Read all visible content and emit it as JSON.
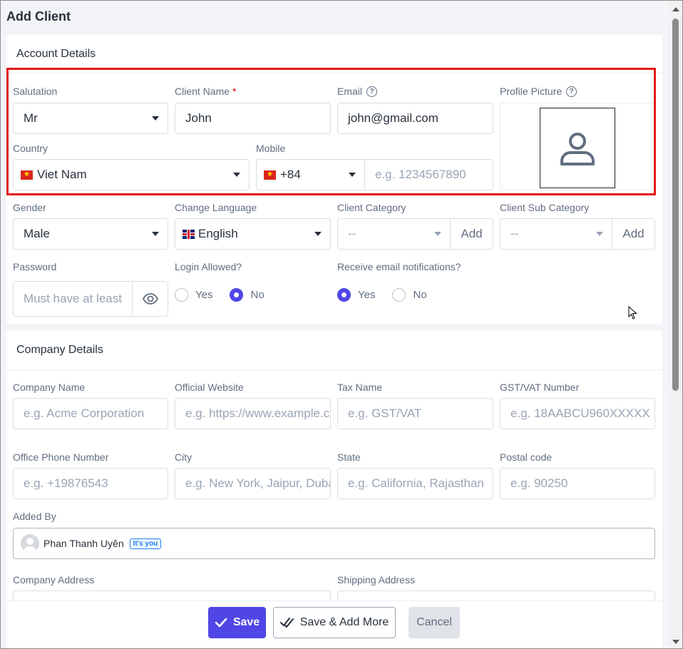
{
  "page": {
    "title": "Add Client"
  },
  "account": {
    "heading": "Account Details",
    "salutation": {
      "label": "Salutation",
      "value": "Mr"
    },
    "client_name": {
      "label": "Client Name",
      "required": "*",
      "value": "John"
    },
    "email": {
      "label": "Email",
      "value": "john@gmail.com"
    },
    "profile_picture": {
      "label": "Profile Picture"
    },
    "country": {
      "label": "Country",
      "value": "Viet Nam"
    },
    "mobile": {
      "label": "Mobile",
      "code": "+84",
      "placeholder": "e.g. 1234567890"
    },
    "gender": {
      "label": "Gender",
      "value": "Male"
    },
    "language": {
      "label": "Change Language",
      "value": "English"
    },
    "client_category": {
      "label": "Client Category",
      "value": "--",
      "add": "Add"
    },
    "client_sub_category": {
      "label": "Client Sub Category",
      "value": "--",
      "add": "Add"
    },
    "password": {
      "label": "Password",
      "placeholder": "Must have at least"
    },
    "login_allowed": {
      "label": "Login Allowed?",
      "yes": "Yes",
      "no": "No",
      "selected": "No"
    },
    "email_notifications": {
      "label": "Receive email notifications?",
      "yes": "Yes",
      "no": "No",
      "selected": "Yes"
    }
  },
  "company": {
    "heading": "Company Details",
    "company_name": {
      "label": "Company Name",
      "placeholder": "e.g. Acme Corporation"
    },
    "website": {
      "label": "Official Website",
      "placeholder": "e.g. https://www.example.com"
    },
    "tax_name": {
      "label": "Tax Name",
      "placeholder": "e.g. GST/VAT"
    },
    "gst": {
      "label": "GST/VAT Number",
      "placeholder": "e.g. 18AABCU960XXXXX"
    },
    "office_phone": {
      "label": "Office Phone Number",
      "placeholder": "e.g. +19876543"
    },
    "city": {
      "label": "City",
      "placeholder": "e.g. New York, Jaipur, Dubai"
    },
    "state": {
      "label": "State",
      "placeholder": "e.g. California, Rajasthan"
    },
    "postal": {
      "label": "Postal code",
      "placeholder": "e.g. 90250"
    },
    "added_by": {
      "label": "Added By",
      "name": "Phan Thanh Uyên",
      "badge": "It's you"
    },
    "company_address": {
      "label": "Company Address"
    },
    "shipping_address": {
      "label": "Shipping Address"
    }
  },
  "footer": {
    "save": "Save",
    "save_more": "Save & Add More",
    "cancel": "Cancel"
  },
  "colors": {
    "primary": "#4f46e5",
    "highlight": "#e21919",
    "required": "#d30000"
  }
}
